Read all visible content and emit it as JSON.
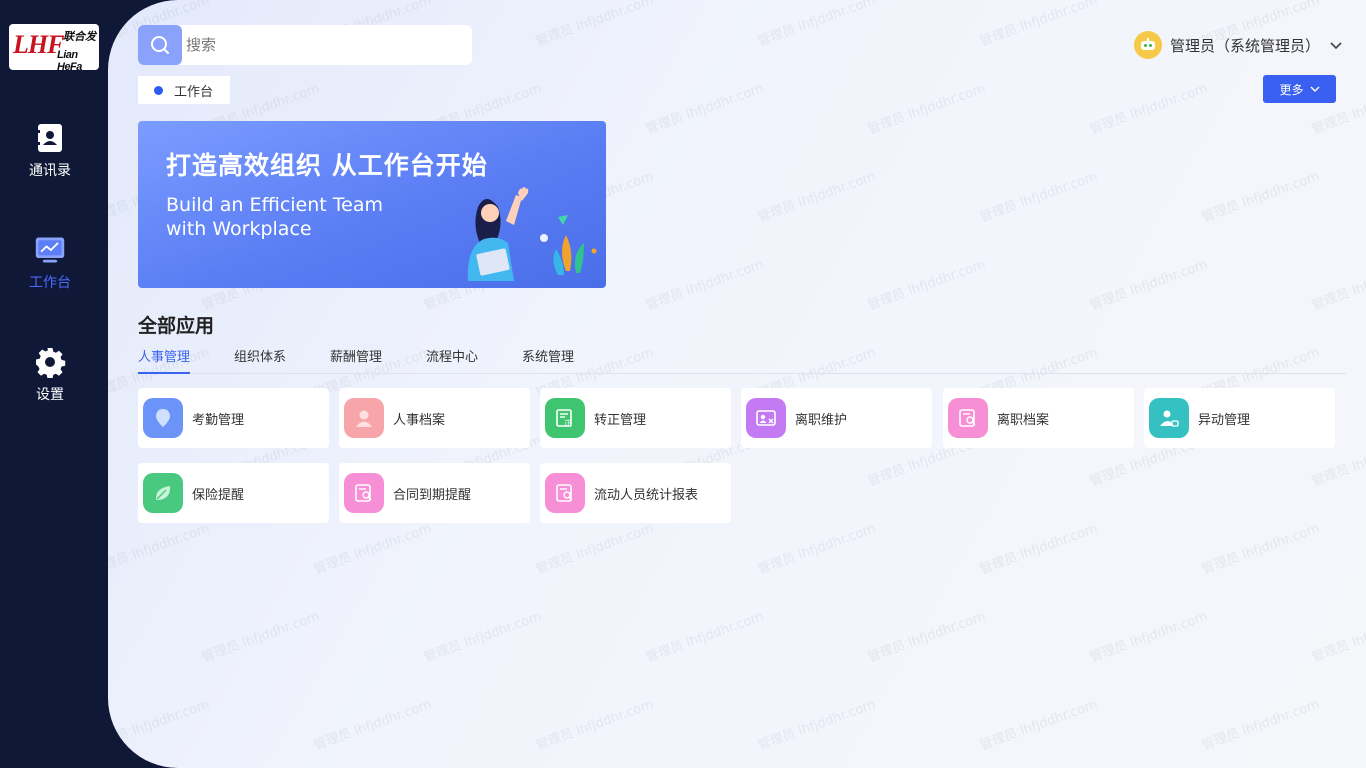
{
  "sidebar": {
    "logo": {
      "mark": "LHF",
      "cn": "联合发",
      "en": "Lian HeFa"
    },
    "items": [
      {
        "label": "通讯录",
        "icon": "contacts-icon"
      },
      {
        "label": "工作台",
        "icon": "workbench-icon",
        "active": true
      },
      {
        "label": "设置",
        "icon": "gear-icon"
      }
    ]
  },
  "search": {
    "placeholder": "搜索"
  },
  "user": {
    "name": "管理员（系统管理员）"
  },
  "tag": {
    "label": "工作台"
  },
  "more_button": {
    "label": "更多"
  },
  "banner": {
    "title": "打造高效组织  从工作台开始",
    "subtitle_line1": "Build an Efficient Team",
    "subtitle_line2": "with Workplace"
  },
  "apps": {
    "title": "全部应用",
    "tabs": [
      "人事管理",
      "组织体系",
      "薪酬管理",
      "流程中心",
      "系统管理"
    ],
    "items": [
      {
        "label": "考勤管理",
        "icon": "location-pin-icon",
        "color": "#6c93f7"
      },
      {
        "label": "人事档案",
        "icon": "person-icon",
        "color": "#f7a5a8"
      },
      {
        "label": "转正管理",
        "icon": "certificate-icon",
        "color": "#3fc46f"
      },
      {
        "label": "离职维护",
        "icon": "id-card-remove-icon",
        "color": "#c47af2"
      },
      {
        "label": "离职档案",
        "icon": "document-search-icon",
        "color": "#f78fd6"
      },
      {
        "label": "异动管理",
        "icon": "user-transfer-icon",
        "color": "#35c1c1"
      },
      {
        "label": "保险提醒",
        "icon": "leaf-icon",
        "color": "#49c980"
      },
      {
        "label": "合同到期提醒",
        "icon": "document-search-icon",
        "color": "#f78fd6"
      },
      {
        "label": "流动人员统计报表",
        "icon": "document-search-icon",
        "color": "#f78fd6"
      }
    ]
  },
  "watermark": {
    "line1": "管理员",
    "line2": "lhfjddhr.com"
  },
  "colors": {
    "accent": "#3960f0",
    "sidebar": "#0f1836",
    "active_nav": "#4b6bff"
  }
}
